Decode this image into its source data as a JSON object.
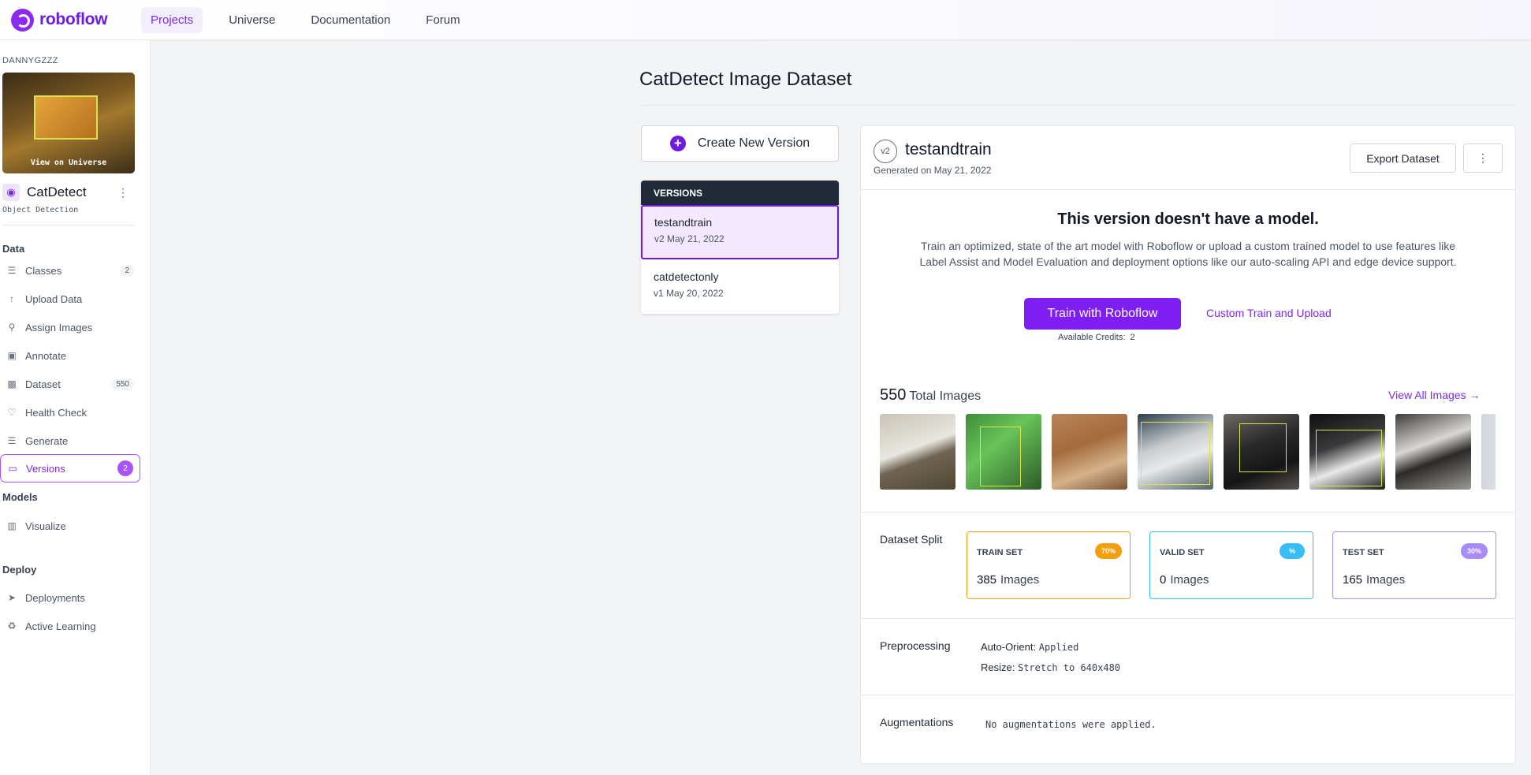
{
  "brand": {
    "name": "roboflow",
    "color": "#6d1be0"
  },
  "nav": {
    "links": [
      "Projects",
      "Universe",
      "Documentation",
      "Forum"
    ],
    "active": "Projects"
  },
  "sidebar": {
    "workspace": "DANNYGZZZ",
    "thumbnail_label": "View on Universe",
    "project_name": "CatDetect",
    "project_type": "Object Detection",
    "sections": {
      "data": "Data",
      "models": "Models",
      "deploy": "Deploy"
    },
    "items": [
      {
        "label": "Classes",
        "icon": "list-icon",
        "count": "2"
      },
      {
        "label": "Upload Data",
        "icon": "upload-icon",
        "count": ""
      },
      {
        "label": "Assign Images",
        "icon": "search-icon",
        "count": ""
      },
      {
        "label": "Annotate",
        "icon": "annotate-icon",
        "count": ""
      },
      {
        "label": "Dataset",
        "icon": "images-icon",
        "count": "550"
      },
      {
        "label": "Health Check",
        "icon": "heart-icon",
        "count": ""
      },
      {
        "label": "Generate",
        "icon": "layers-icon",
        "count": ""
      },
      {
        "label": "Versions",
        "icon": "versions-icon",
        "count": "2",
        "active": true
      },
      {
        "label": "Visualize",
        "icon": "chart-icon",
        "count": ""
      },
      {
        "label": "Deployments",
        "icon": "rocket-icon",
        "count": ""
      },
      {
        "label": "Active Learning",
        "icon": "recycle-icon",
        "count": ""
      }
    ]
  },
  "main": {
    "title": "CatDetect Image Dataset",
    "create_version_label": "Create New Version",
    "versions_header": "VERSIONS",
    "versions": [
      {
        "name": "testandtrain",
        "meta": "v2 May 21, 2022",
        "selected": true
      },
      {
        "name": "catdetectonly",
        "meta": "v1 May 20, 2022",
        "selected": false
      }
    ]
  },
  "version": {
    "badge": "v2",
    "name": "testandtrain",
    "generated": "Generated on May 21, 2022",
    "export_label": "Export Dataset",
    "no_model_title": "This version doesn't have a model.",
    "no_model_desc": "Train an optimized, state of the art model with Roboflow or upload a custom trained model to use features like Label Assist and Model Evaluation and deployment options like our auto-scaling API and edge device support.",
    "train_label": "Train with Roboflow",
    "custom_label": "Custom Train and Upload",
    "credits_label": "Available Credits:",
    "credits_value": "2",
    "total_count": "550",
    "total_label": "Total Images",
    "view_all_label": "View All Images",
    "split_label": "Dataset Split",
    "splits": [
      {
        "name": "TRAIN SET",
        "pill": "70%",
        "count": "385",
        "unit": "Images",
        "color": "#f59e0b"
      },
      {
        "name": "VALID SET",
        "pill": "%",
        "count": "0",
        "unit": "Images",
        "color": "#38bdf8"
      },
      {
        "name": "TEST SET",
        "pill": "30%",
        "count": "165",
        "unit": "Images",
        "color": "#a78bfa"
      }
    ],
    "preprocessing_label": "Preprocessing",
    "preprocessing": [
      {
        "key": "Auto-Orient:",
        "value": "Applied"
      },
      {
        "key": "Resize:",
        "value": "Stretch to 640x480"
      }
    ],
    "augmentations_label": "Augmentations",
    "augmentations_value": "No augmentations were applied."
  }
}
